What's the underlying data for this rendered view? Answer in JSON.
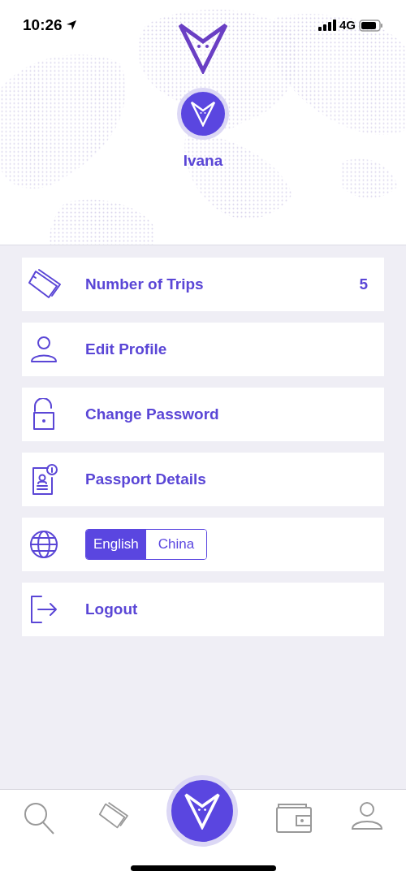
{
  "status_bar": {
    "time": "10:26",
    "network": "4G"
  },
  "profile": {
    "name": "Ivana"
  },
  "menu": [
    {
      "kind": "link",
      "label": "Number of Trips",
      "value": "5"
    },
    {
      "kind": "link",
      "label": "Edit Profile"
    },
    {
      "kind": "link",
      "label": "Change Password"
    },
    {
      "kind": "link",
      "label": "Passport Details"
    },
    {
      "kind": "language",
      "options": [
        {
          "label": "English",
          "selected": true
        },
        {
          "label": "China",
          "selected": false
        }
      ]
    },
    {
      "kind": "link",
      "label": "Logout"
    }
  ]
}
